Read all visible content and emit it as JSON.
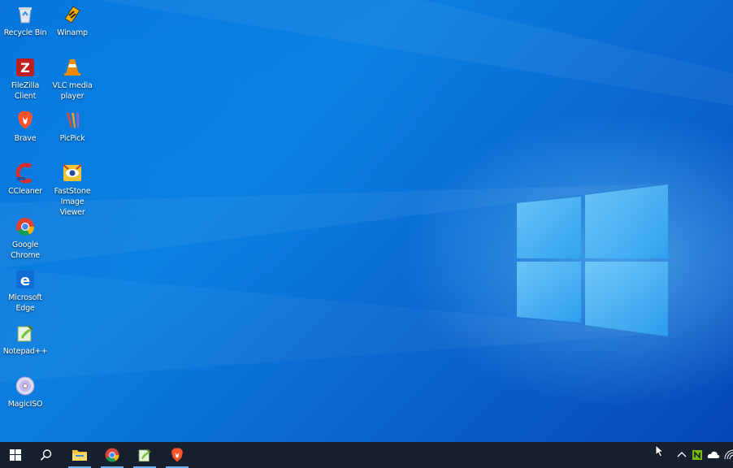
{
  "desktop": {
    "icons": [
      {
        "label": "Recycle Bin",
        "icon": "recycle-bin-icon"
      },
      {
        "label": "Winamp",
        "icon": "winamp-icon"
      },
      {
        "label": "FileZilla Client",
        "icon": "filezilla-icon"
      },
      {
        "label": "VLC media player",
        "icon": "vlc-icon"
      },
      {
        "label": "Brave",
        "icon": "brave-icon"
      },
      {
        "label": "PicPick",
        "icon": "picpick-icon"
      },
      {
        "label": "CCleaner",
        "icon": "ccleaner-icon"
      },
      {
        "label": "FastStone Image Viewer",
        "icon": "faststone-icon"
      },
      {
        "label": "Google Chrome",
        "icon": "chrome-icon"
      },
      {
        "label": "Microsoft Edge",
        "icon": "edge-icon"
      },
      {
        "label": "Notepad++",
        "icon": "notepadpp-icon"
      },
      {
        "label": "MagicISO",
        "icon": "magiciso-icon"
      }
    ]
  },
  "taskbar": {
    "items": [
      {
        "name": "start",
        "icon": "windows-logo-icon"
      },
      {
        "name": "search",
        "icon": "search-icon"
      },
      {
        "name": "file-explorer",
        "icon": "folder-icon",
        "active": true
      },
      {
        "name": "google-chrome",
        "icon": "chrome-icon",
        "active": true
      },
      {
        "name": "notepadpp",
        "icon": "notepadpp-icon",
        "active": true
      },
      {
        "name": "brave",
        "icon": "brave-icon",
        "active": true
      }
    ],
    "tray": [
      {
        "name": "show-hidden",
        "icon": "chevron-up-icon"
      },
      {
        "name": "nvidia",
        "icon": "nvidia-icon"
      },
      {
        "name": "onedrive",
        "icon": "cloud-icon"
      },
      {
        "name": "wifi",
        "icon": "wifi-icon"
      }
    ]
  },
  "colors": {
    "wallpaper": "#0a6fd6",
    "taskbar": "#16212d",
    "accent": "#6ab0f0"
  }
}
